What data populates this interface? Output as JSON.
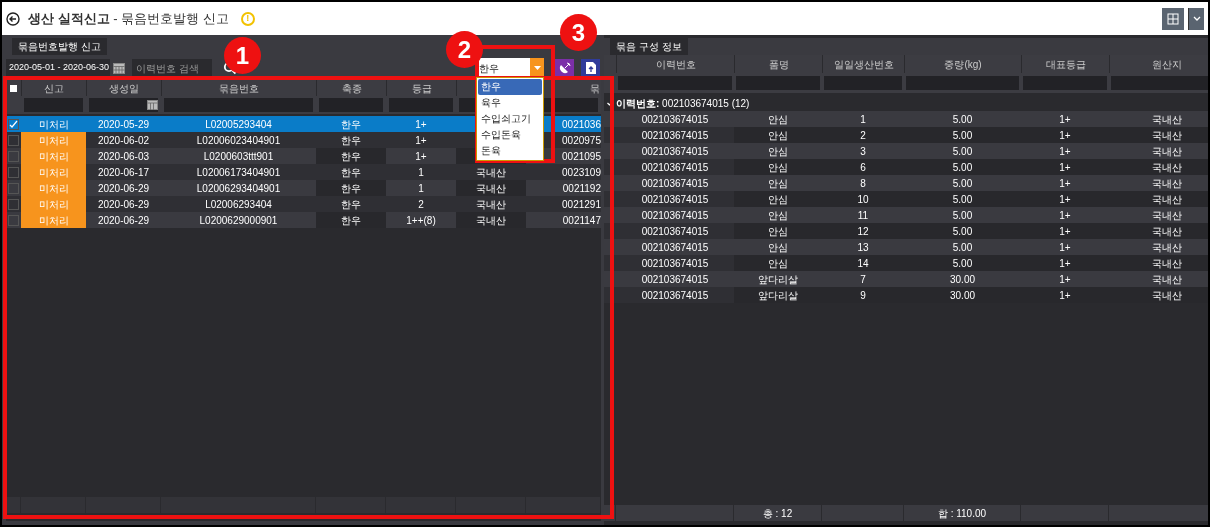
{
  "window": {
    "title": "**생산 실적신고** - 묶음번호발행 신고",
    "warning": "!"
  },
  "left_panel": {
    "tab": "묶음번호발행 신고",
    "date_range": "2020-05-01 - 2020-06-30",
    "search": {
      "placeholder": "이력번호 검색"
    },
    "species_dropdown": {
      "value": "한우",
      "expanded": true,
      "options": [
        {
          "label": "한우",
          "selected": true
        },
        {
          "label": "육우",
          "selected": false
        },
        {
          "label": "수입쇠고기",
          "selected": false
        },
        {
          "label": "수입돈육",
          "selected": false
        },
        {
          "label": "돈육",
          "selected": false
        }
      ]
    },
    "header_checked": false,
    "columns": [
      "신고",
      "생성일",
      "묶음번호",
      "축종",
      "등급",
      "",
      "묶"
    ],
    "rows": [
      {
        "selected": true,
        "checked": true,
        "status": "미처리",
        "date": "2020-05-29",
        "bundle_no": "L02005293404",
        "species": "한우",
        "grade": "1+",
        "column_7": "0021036"
      },
      {
        "selected": false,
        "checked": false,
        "status": "미처리",
        "date": "2020-06-02",
        "bundle_no": "L02006023404901",
        "species": "한우",
        "grade": "1+",
        "column_7": "0020975"
      },
      {
        "selected": false,
        "checked": false,
        "status": "미처리",
        "date": "2020-06-03",
        "bundle_no": "L0200603ttt901",
        "species": "한우",
        "grade": "1+",
        "column_7": "0021095"
      },
      {
        "selected": false,
        "checked": false,
        "status": "미처리",
        "date": "2020-06-17",
        "bundle_no": "L02006173404901",
        "species": "한우",
        "grade": "1",
        "origin": "국내산",
        "column_7": "0023109"
      },
      {
        "selected": false,
        "checked": false,
        "status": "미처리",
        "date": "2020-06-29",
        "bundle_no": "L02006293404901",
        "species": "한우",
        "grade": "1",
        "origin": "국내산",
        "column_7": "0021192"
      },
      {
        "selected": false,
        "checked": false,
        "status": "미처리",
        "date": "2020-06-29",
        "bundle_no": "L02006293404",
        "species": "한우",
        "grade": "2",
        "origin": "국내산",
        "column_7": "0021291"
      },
      {
        "selected": false,
        "checked": false,
        "status": "미처리",
        "date": "2020-06-29",
        "bundle_no": "L0200629000901",
        "species": "한우",
        "grade": "1++(8)",
        "origin": "국내산",
        "column_7": "0021147"
      }
    ]
  },
  "right_panel": {
    "tab": "묶음 구성 정보",
    "columns": [
      "이력번호",
      "품명",
      "일일생산번호",
      "중량(kg)",
      "대표등급",
      "원산지"
    ],
    "group": {
      "label": "**이력번호:** 002103674015 (12)",
      "expanded": true
    },
    "rows": [
      [
        "002103674015",
        "안심",
        "1",
        "5.00",
        "1+",
        "국내산"
      ],
      [
        "002103674015",
        "안심",
        "2",
        "5.00",
        "1+",
        "국내산"
      ],
      [
        "002103674015",
        "안심",
        "3",
        "5.00",
        "1+",
        "국내산"
      ],
      [
        "002103674015",
        "안심",
        "6",
        "5.00",
        "1+",
        "국내산"
      ],
      [
        "002103674015",
        "안심",
        "8",
        "5.00",
        "1+",
        "국내산"
      ],
      [
        "002103674015",
        "안심",
        "10",
        "5.00",
        "1+",
        "국내산"
      ],
      [
        "002103674015",
        "안심",
        "11",
        "5.00",
        "1+",
        "국내산"
      ],
      [
        "002103674015",
        "안심",
        "12",
        "5.00",
        "1+",
        "국내산"
      ],
      [
        "002103674015",
        "안심",
        "13",
        "5.00",
        "1+",
        "국내산"
      ],
      [
        "002103674015",
        "안심",
        "14",
        "5.00",
        "1+",
        "국내산"
      ],
      [
        "002103674015",
        "앞다리살",
        "7",
        "30.00",
        "1+",
        "국내산"
      ],
      [
        "002103674015",
        "앞다리살",
        "9",
        "30.00",
        "1+",
        "국내산"
      ]
    ],
    "footer": {
      "count": "총 : 12",
      "sum": "합 : 110.00"
    }
  },
  "annotations": [
    {
      "label": "1"
    },
    {
      "label": "2"
    },
    {
      "label": "3"
    }
  ]
}
